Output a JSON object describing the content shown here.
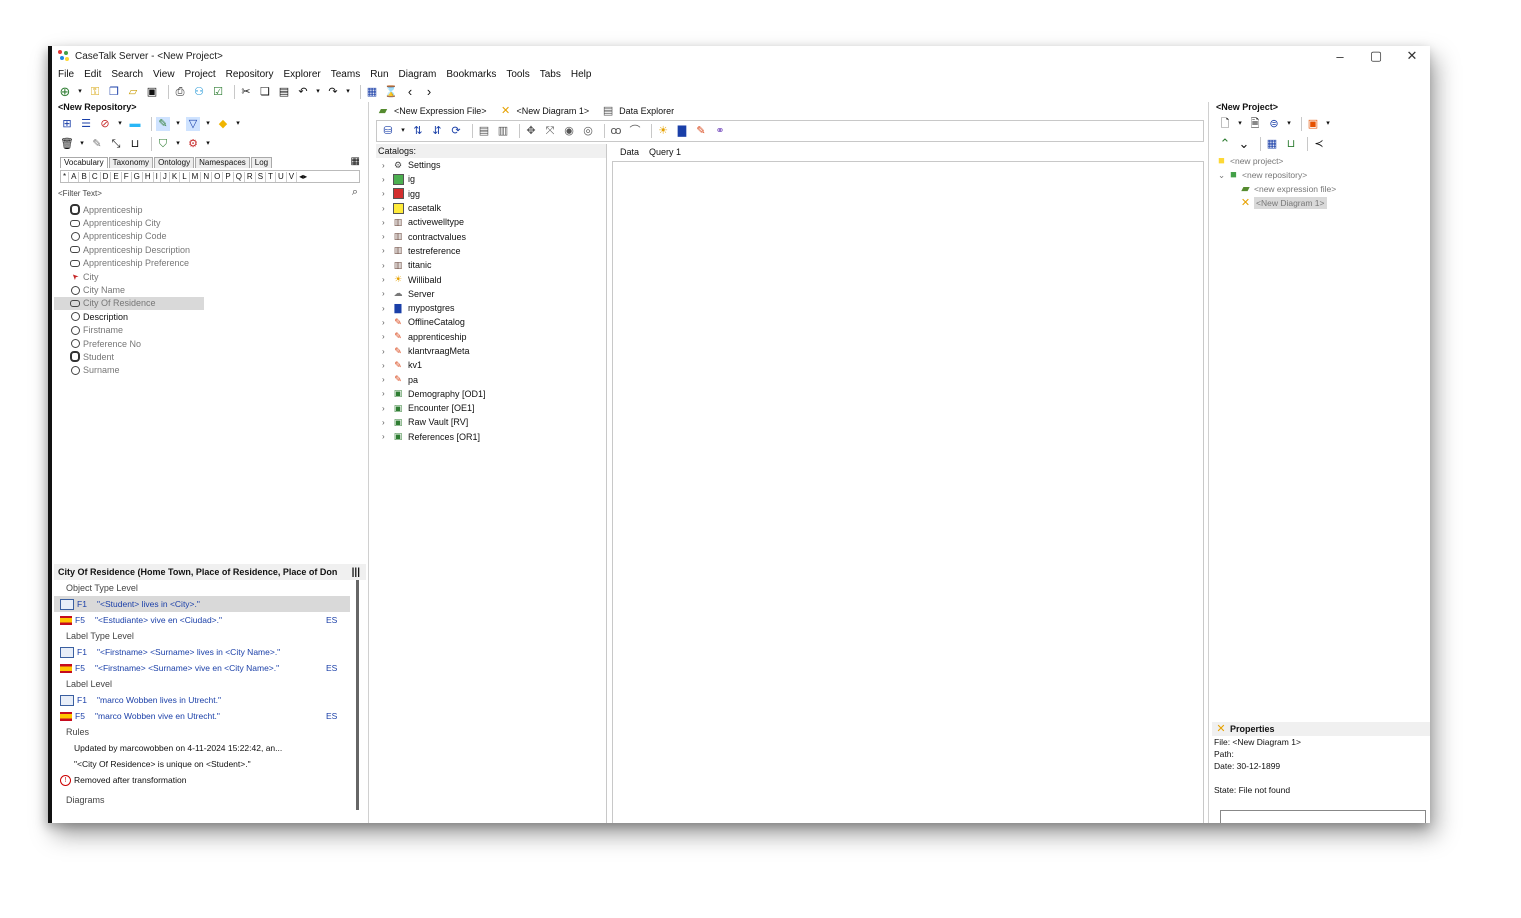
{
  "window": {
    "title": "CaseTalk Server - <New Project>",
    "controls": [
      "–",
      "▢",
      "✕"
    ]
  },
  "menu": [
    "File",
    "Edit",
    "Search",
    "View",
    "Project",
    "Repository",
    "Explorer",
    "Teams",
    "Run",
    "Diagram",
    "Bookmarks",
    "Tools",
    "Tabs",
    "Help"
  ],
  "left": {
    "header": "<New Repository>",
    "tabs": [
      "Vocabulary",
      "Taxonomy",
      "Ontology",
      "Namespaces",
      "Log"
    ],
    "alphabet": [
      "*",
      "A",
      "B",
      "C",
      "D",
      "E",
      "F",
      "G",
      "H",
      "I",
      "J",
      "K",
      "L",
      "M",
      "N",
      "O",
      "P",
      "Q",
      "R",
      "S",
      "T",
      "U",
      "V"
    ],
    "filter_placeholder": "<Filter Text>",
    "vocab": [
      {
        "label": "Apprenticeship",
        "icon": "ringbar2",
        "dark": false
      },
      {
        "label": "Apprenticeship City",
        "icon": "ringbar",
        "dark": false
      },
      {
        "label": "Apprenticeship Code",
        "icon": "ring",
        "dark": false
      },
      {
        "label": "Apprenticeship Description",
        "icon": "ringbar",
        "dark": false
      },
      {
        "label": "Apprenticeship Preference",
        "icon": "ringbar",
        "dark": false
      },
      {
        "label": "City",
        "icon": "arrow",
        "dark": false
      },
      {
        "label": "City Name",
        "icon": "ring",
        "dark": false
      },
      {
        "label": "City Of Residence",
        "icon": "ringbar",
        "dark": false,
        "selected": true
      },
      {
        "label": "Description",
        "icon": "ring",
        "dark": true
      },
      {
        "label": "Firstname",
        "icon": "ring",
        "dark": false
      },
      {
        "label": "Preference No",
        "icon": "ring",
        "dark": false
      },
      {
        "label": "Student",
        "icon": "ringbar2",
        "dark": false
      },
      {
        "label": "Surname",
        "icon": "ring",
        "dark": false
      }
    ],
    "facts": {
      "title": "City Of Residence (Home Town, Place of Residence, Place of Don",
      "object_level": "Object Type Level",
      "label_type_level": "Label Type Level",
      "label_level": "Label Level",
      "rules_level": "Rules",
      "diagrams_level": "Diagrams",
      "object_rows": [
        {
          "flag": "uk",
          "code": "F1",
          "text": "\"<Student> lives in <City>.\"",
          "lang": "",
          "sel": true
        },
        {
          "flag": "es",
          "code": "F5",
          "text": "\"<Estudiante> vive en <Ciudad>.\"",
          "lang": "ES"
        }
      ],
      "label_type_rows": [
        {
          "flag": "uk",
          "code": "F1",
          "text": "\"<Firstname> <Surname> lives in <City Name>.\"",
          "lang": ""
        },
        {
          "flag": "es",
          "code": "F5",
          "text": "\"<Firstname> <Surname> vive en <City Name>.\"",
          "lang": "ES"
        }
      ],
      "label_rows": [
        {
          "flag": "uk",
          "code": "F1",
          "text": "\"marco Wobben lives in Utrecht.\"",
          "lang": ""
        },
        {
          "flag": "es",
          "code": "F5",
          "text": "\"marco Wobben vive en Utrecht.\"",
          "lang": "ES"
        }
      ],
      "rules": [
        "Updated by marcowobben on 4-11-2024 15:22:42, an...",
        "\"<City Of Residence> is unique on <Student>.\""
      ],
      "removed": "Removed after transformation"
    }
  },
  "middle": {
    "doc_tabs": [
      "<New Expression File>",
      "<New Diagram 1>",
      "Data Explorer"
    ],
    "catalogs_label": "Catalogs:",
    "catalogs": [
      {
        "label": "Settings",
        "icon": "gear"
      },
      {
        "label": "ig",
        "icon": "green"
      },
      {
        "label": "igg",
        "icon": "red"
      },
      {
        "label": "casetalk",
        "icon": "yellow"
      },
      {
        "label": "activewelltype",
        "icon": "books"
      },
      {
        "label": "contractvalues",
        "icon": "books"
      },
      {
        "label": "testreference",
        "icon": "books"
      },
      {
        "label": "titanic",
        "icon": "books"
      },
      {
        "label": "Willibald",
        "icon": "bulb"
      },
      {
        "label": "Server",
        "icon": "cloud"
      },
      {
        "label": "mypostgres",
        "icon": "db"
      },
      {
        "label": "OfflineCatalog",
        "icon": "pencil"
      },
      {
        "label": "apprenticeship",
        "icon": "pencil"
      },
      {
        "label": "klantvraagMeta",
        "icon": "pencil"
      },
      {
        "label": "kv1",
        "icon": "pencil"
      },
      {
        "label": "pa",
        "icon": "pencil"
      },
      {
        "label": "Demography [OD1]",
        "icon": "box"
      },
      {
        "label": "Encounter [OE1]",
        "icon": "box"
      },
      {
        "label": "Raw Vault [RV]",
        "icon": "box"
      },
      {
        "label": "References [OR1]",
        "icon": "box"
      }
    ],
    "query_tabs": [
      "Data",
      "Query 1"
    ]
  },
  "right": {
    "header": "<New Project>",
    "tree": [
      {
        "label": "<new project>",
        "indent": 0
      },
      {
        "label": "<new repository>",
        "indent": 1
      },
      {
        "label": "<new expression file>",
        "indent": 2
      },
      {
        "label": "<New Diagram 1>",
        "indent": 2,
        "sel": true
      }
    ],
    "properties": {
      "title": "Properties",
      "file": "File: <New Diagram 1>",
      "path": "Path:",
      "date": "Date: 30-12-1899",
      "state": "State: File not found"
    }
  },
  "colors": {
    "accent_blue": "#1a3fa8",
    "selection": "#d9d9d9"
  }
}
